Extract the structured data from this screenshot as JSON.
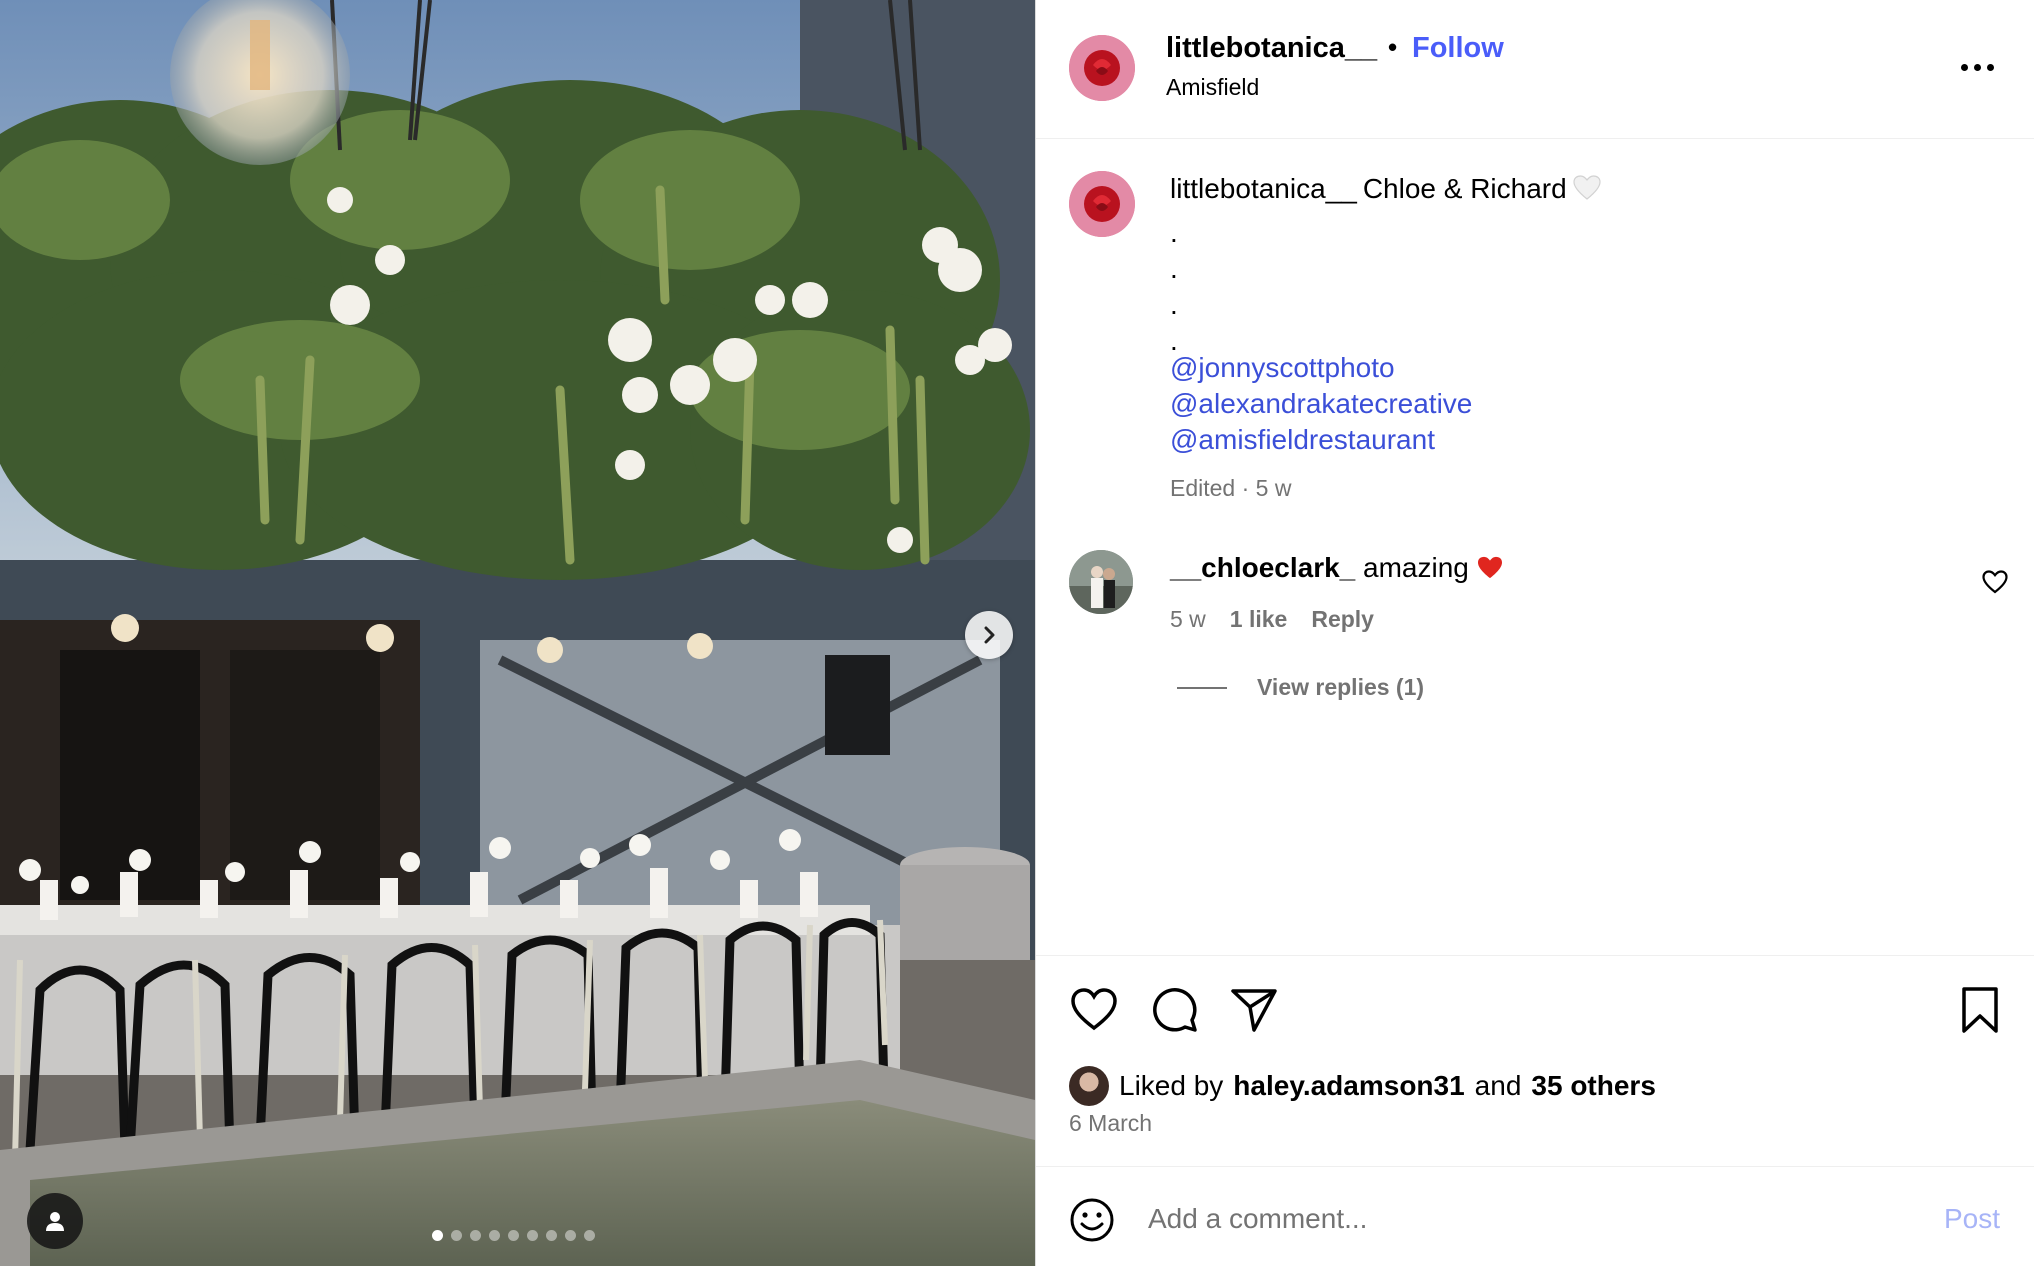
{
  "post": {
    "username": "littlebotanica__",
    "separator": "•",
    "follow_label": "Follow",
    "location": "Amisfield"
  },
  "caption": {
    "username": "littlebotanica__",
    "text": "Chloe & Richard",
    "heart_icon": "white-heart-emoji",
    "dots": [
      ".",
      ".",
      ".",
      "."
    ],
    "mentions": [
      "@jonnyscottphoto",
      "@alexandrakatecreative",
      "@amisfieldrestaurant"
    ],
    "meta": "Edited · 5 w"
  },
  "comment": {
    "username": "__chloeclark_",
    "text": "amazing",
    "emoji": "❤️",
    "time": "5 w",
    "likes": "1 like",
    "reply_label": "Reply",
    "view_replies": "View replies (1)"
  },
  "engagement": {
    "liked_prefix": "Liked by",
    "liked_user": "haley.adamson31",
    "liked_and": "and",
    "liked_others": "35 others",
    "date": "6 March"
  },
  "composer": {
    "placeholder": "Add a comment...",
    "post_label": "Post"
  },
  "carousel": {
    "total": 9,
    "active_index": 0
  },
  "colors": {
    "link_blue": "#4a5df9",
    "mention_blue": "#3b4fd8",
    "muted": "#737373",
    "post_disabled": "#a7b4f7"
  }
}
